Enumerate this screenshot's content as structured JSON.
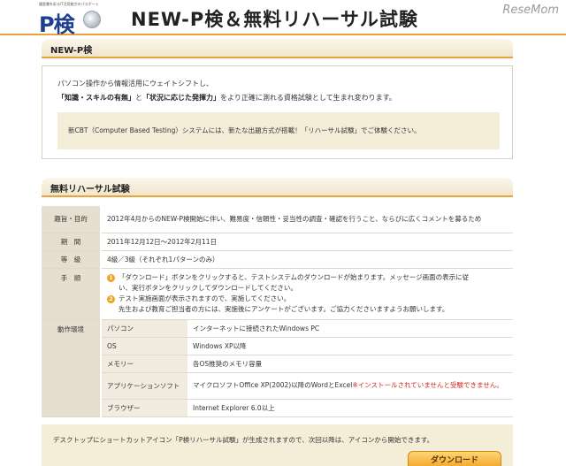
{
  "header": {
    "logo_tagline": "履歴書を彩るIT活用能力のパスポート",
    "logo_text": "P検",
    "title": "NEW-P検＆無料リハーサル試験",
    "watermark": "ReseMom"
  },
  "section1": {
    "heading": "NEW-P検",
    "intro_line1": "パソコン操作から情報活用にウェイトシフトし、",
    "intro_bold1": "「知識・スキルの有無」",
    "intro_mid": "と",
    "intro_bold2": "「状況に応じた発揮力」",
    "intro_end": "をより正確に測れる資格試験として生まれ変わります。",
    "cbt_note": "新CBT（Computer Based Testing）システムには、新たな出題方式が搭載！「リハーサル試験」でご体験ください。"
  },
  "section2": {
    "heading": "無料リハーサル試験",
    "rows": {
      "purpose_label": "趣旨・目的",
      "purpose_value": "2012年4月からのNEW-P検開始に伴い、難易度・信頼性・妥当性の調査・確認を行うこと、ならびに広くコメントを募るため",
      "period_label": "期　間",
      "period_value": "2011年12月12日〜2012年2月11日",
      "level_label": "等　級",
      "level_value": "4級／3級（それぞれ1パターンのみ）",
      "steps_label": "手　順",
      "step1_num": "1",
      "step1_line1": "「ダウンロード」ボタンをクリックすると、テストシステムのダウンロードが始まります。メッセージ画面の表示に従",
      "step1_line2": "い、実行ボタンをクリックしてダウンロードしてください。",
      "step2_num": "2",
      "step2_line1": "テスト実施画面が表示されますので、実施してください。",
      "step2_line2": "先生および教育ご担当者の方には、実施後にアンケートがございます。ご協力くださいますようお願いします。",
      "env_label": "動作環境",
      "env": [
        {
          "name": "パソコン",
          "value": "インターネットに接続されたWindows PC"
        },
        {
          "name": "OS",
          "value": "Windows XP以降"
        },
        {
          "name": "メモリー",
          "value": "各OS推奨のメモリ容量"
        },
        {
          "name": "アプリケーションソフト",
          "value": "マイクロソフトOffice XP(2002)以降のWordとExcel",
          "note": "※インストールされていませんと受験できません。"
        },
        {
          "name": "ブラウザー",
          "value": "Internet Explorer 6.0以上"
        }
      ]
    }
  },
  "bottom": {
    "shortcut_note": "デスクトップにショートカットアイコン「P検リハーサル試験」が生成されますので、次回以降は、アイコンから開始できます。",
    "download_label": "ダウンロード"
  },
  "colors": {
    "accent": "#e6a43a",
    "note_red": "#d8261c",
    "panel_beige": "#f4eed9"
  }
}
